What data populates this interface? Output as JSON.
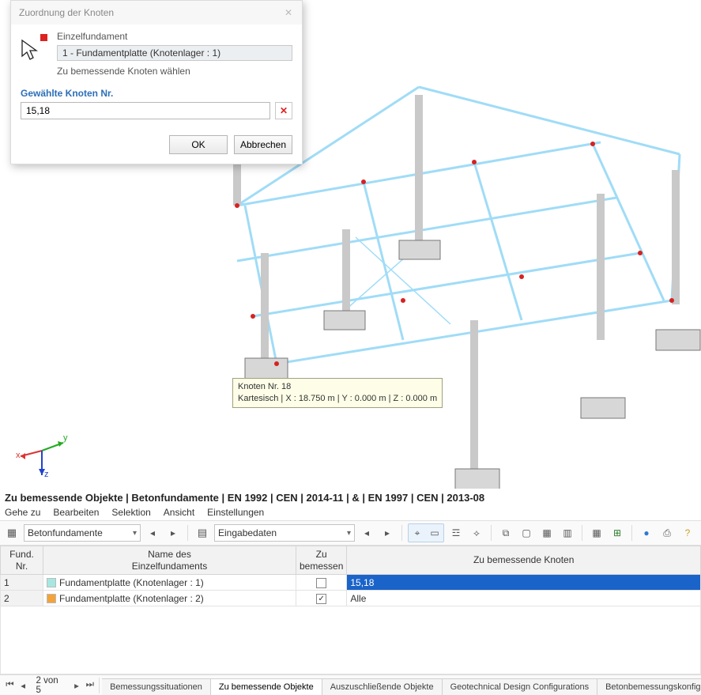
{
  "dialog": {
    "title": "Zuordnung der Knoten",
    "info": {
      "heading": "Einzelfundament",
      "selection": "1 - Fundamentplatte (Knotenlager : 1)",
      "instruction": "Zu bemessende Knoten wählen"
    },
    "selected_label": "Gewählte Knoten Nr.",
    "selected_value": "15,18",
    "ok": "OK",
    "cancel": "Abbrechen"
  },
  "tooltip": {
    "line1": "Knoten Nr. 18",
    "line2": "Kartesisch | X : 18.750 m | Y : 0.000 m | Z : 0.000 m"
  },
  "axis": {
    "x": "x",
    "y": "y",
    "z": "z"
  },
  "panel": {
    "title": "Zu bemessende Objekte | Betonfundamente | EN 1992 | CEN | 2014-11 | & | EN 1997 | CEN | 2013-08",
    "menu": [
      "Gehe zu",
      "Bearbeiten",
      "Selektion",
      "Ansicht",
      "Einstellungen"
    ],
    "combo1": "Betonfundamente",
    "combo2": "Eingabedaten",
    "columns": {
      "c1a": "Fund.",
      "c1b": "Nr.",
      "c2a": "Name des",
      "c2b": "Einzelfundaments",
      "c3a": "Zu",
      "c3b": "bemessen",
      "c4": "Zu bemessende Knoten"
    },
    "rows": [
      {
        "num": "1",
        "name": "Fundamentplatte (Knotenlager : 1)",
        "checked": false,
        "nodes": "15,18",
        "color": "#a6e7e1",
        "selected": true
      },
      {
        "num": "2",
        "name": "Fundamentplatte (Knotenlager : 2)",
        "checked": true,
        "nodes": "Alle",
        "color": "#f3a33a",
        "selected": false
      }
    ]
  },
  "footer": {
    "page": "2 von 5",
    "tabs": [
      {
        "label": "Bemessungssituationen",
        "active": false
      },
      {
        "label": "Zu bemessende Objekte",
        "active": true
      },
      {
        "label": "Auszuschließende Objekte",
        "active": false
      },
      {
        "label": "Geotechnical Design Configurations",
        "active": false
      },
      {
        "label": "Betonbemessungskonfigurationen",
        "active": false
      }
    ]
  }
}
